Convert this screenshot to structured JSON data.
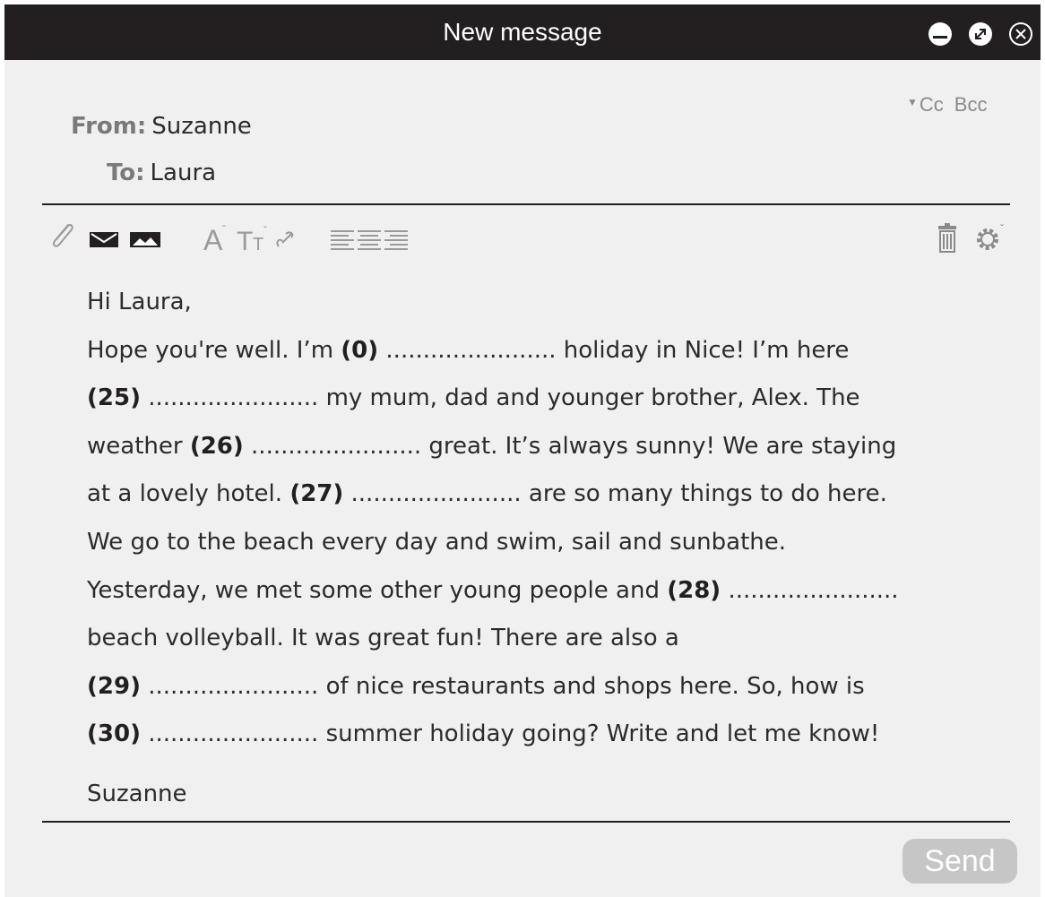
{
  "window": {
    "title": "New message"
  },
  "header": {
    "cc_label": "Cc",
    "bcc_label": "Bcc",
    "from_label": "From:",
    "from_value": "Suzanne",
    "to_label": "To:",
    "to_value": "Laura"
  },
  "toolbar": {
    "left_icons": [
      "paperclip-icon",
      "envelope-icon",
      "image-icon"
    ],
    "format_icons": [
      "font-size-icon",
      "text-size-icon",
      "link-icon"
    ],
    "align_icons": [
      "align-left-icon",
      "align-center-icon",
      "align-right-icon"
    ],
    "right_icons": [
      "trash-icon",
      "settings-icon"
    ]
  },
  "message": {
    "lines": [
      [
        {
          "t": "Hi Laura,"
        }
      ],
      [
        {
          "t": "Hope you're well. I’m "
        },
        {
          "b": "(0)"
        },
        {
          "t": " ....................... holiday in Nice! I’m here"
        }
      ],
      [
        {
          "b": "(25)"
        },
        {
          "t": " ....................... my mum, dad and younger brother, Alex. The"
        }
      ],
      [
        {
          "t": "weather "
        },
        {
          "b": "(26)"
        },
        {
          "t": " .......................  great. It’s always sunny! We are staying"
        }
      ],
      [
        {
          "t": "at a lovely hotel. "
        },
        {
          "b": "(27)"
        },
        {
          "t": " ....................... are so many things to do here."
        }
      ],
      [
        {
          "t": "We go to the beach every day and swim, sail and sunbathe."
        }
      ],
      [
        {
          "t": "Yesterday, we met some other young people and "
        },
        {
          "b": "(28)"
        },
        {
          "t": " ......................."
        }
      ],
      [
        {
          "t": "beach volleyball. It was great fun! There are also a"
        }
      ],
      [
        {
          "b": "(29)"
        },
        {
          "t": " ....................... of nice restaurants and shops here. So, how is"
        }
      ],
      [
        {
          "b": "(30)"
        },
        {
          "t": " ....................... summer holiday going? Write and let me know!"
        }
      ]
    ],
    "signature": "Suzanne"
  },
  "footer": {
    "send_label": "Send"
  },
  "colors": {
    "titlebar": "#231f20",
    "background": "#f0f0f0",
    "send_button": "#c6c6c6",
    "label_gray": "#7a7a7a"
  }
}
